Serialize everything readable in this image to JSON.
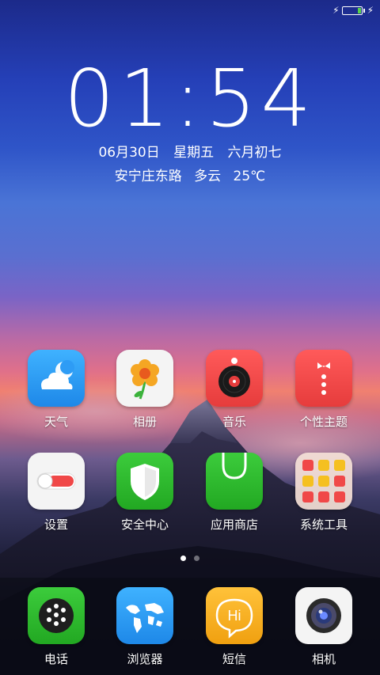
{
  "status_bar": {
    "battery_icon": "battery-icon",
    "charging_icon": "charging-bolt-icon",
    "battery_level_fraction": 0.15
  },
  "lock_clock": {
    "time": "01:54",
    "date": "06月30日",
    "weekday": "星期五",
    "lunar_date": "六月初七",
    "location": "安宁庄东路",
    "weather": "多云",
    "temperature": "25℃"
  },
  "home_apps": [
    {
      "label": "天气",
      "icon": "weather-icon",
      "color": "#2e9cf5"
    },
    {
      "label": "相册",
      "icon": "gallery-flower-icon",
      "color": "#f2f2f2"
    },
    {
      "label": "音乐",
      "icon": "music-record-icon",
      "color": "#f04848"
    },
    {
      "label": "个性主题",
      "icon": "theme-shirt-icon",
      "color": "#f04848"
    },
    {
      "label": "设置",
      "icon": "settings-toggle-icon",
      "color": "#f2f2f2"
    },
    {
      "label": "安全中心",
      "icon": "security-shield-icon",
      "color": "#2dbd2d"
    },
    {
      "label": "应用商店",
      "icon": "app-store-bag-icon",
      "color": "#2dbd2d"
    },
    {
      "label": "系统工具",
      "icon": "system-tools-folder-icon",
      "color": "#f5e6dc"
    }
  ],
  "page_indicator": {
    "total": 2,
    "current": 1
  },
  "dock_apps": [
    {
      "label": "电话",
      "icon": "phone-dial-icon",
      "color": "#2dbd2d"
    },
    {
      "label": "浏览器",
      "icon": "browser-globe-icon",
      "color": "#2a9cf0"
    },
    {
      "label": "短信",
      "icon": "messages-hi-icon",
      "color": "#f5b020"
    },
    {
      "label": "相机",
      "icon": "camera-lens-icon",
      "color": "#f2f2f2"
    }
  ],
  "icon_text": {
    "messages_bubble": "Hi"
  }
}
